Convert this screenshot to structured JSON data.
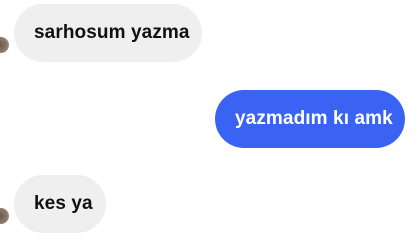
{
  "messages": [
    {
      "text": "sarhosum yazma",
      "direction": "incoming"
    },
    {
      "text": "yazmadım kı amk",
      "direction": "outgoing"
    },
    {
      "text": "kes ya",
      "direction": "incoming"
    }
  ],
  "colors": {
    "incoming_bubble": "#efefef",
    "incoming_text": "#111111",
    "outgoing_bubble": "#3a63f4",
    "outgoing_text": "#ffffff"
  }
}
